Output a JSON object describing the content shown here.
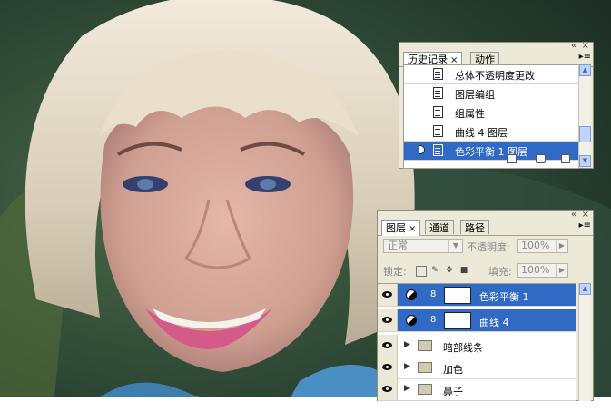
{
  "history_panel": {
    "tabs": [
      {
        "label": "历史记录",
        "close": "×"
      },
      {
        "label": "动作"
      }
    ],
    "items": [
      {
        "label": "总体不透明度更改"
      },
      {
        "label": "图层编组"
      },
      {
        "label": "组属性"
      },
      {
        "label": "曲线 4 图层"
      },
      {
        "label": "色彩平衡 1 图层",
        "selected": true
      }
    ],
    "footer_icons": [
      "new-document-icon",
      "new-snapshot-icon",
      "trash-icon"
    ]
  },
  "layers_panel": {
    "tabs": [
      {
        "label": "图层",
        "close": "×"
      },
      {
        "label": "通道"
      },
      {
        "label": "路径"
      }
    ],
    "blend_mode": "正常",
    "opacity_label": "不透明度:",
    "opacity_value": "100%",
    "lock_label": "锁定:",
    "fill_label": "填充:",
    "fill_value": "100%",
    "layers": [
      {
        "name": "色彩平衡 1",
        "type": "adjustment",
        "selected": true
      },
      {
        "name": "曲线 4",
        "type": "adjustment",
        "selected": true
      },
      {
        "name": "暗部线条",
        "type": "group"
      },
      {
        "name": "加色",
        "type": "group"
      },
      {
        "name": "鼻子",
        "type": "group"
      }
    ]
  },
  "colors": {
    "panel_bg": "#ece9d8",
    "selection": "#316ac5",
    "scroll_accent": "#c1d3fb"
  }
}
